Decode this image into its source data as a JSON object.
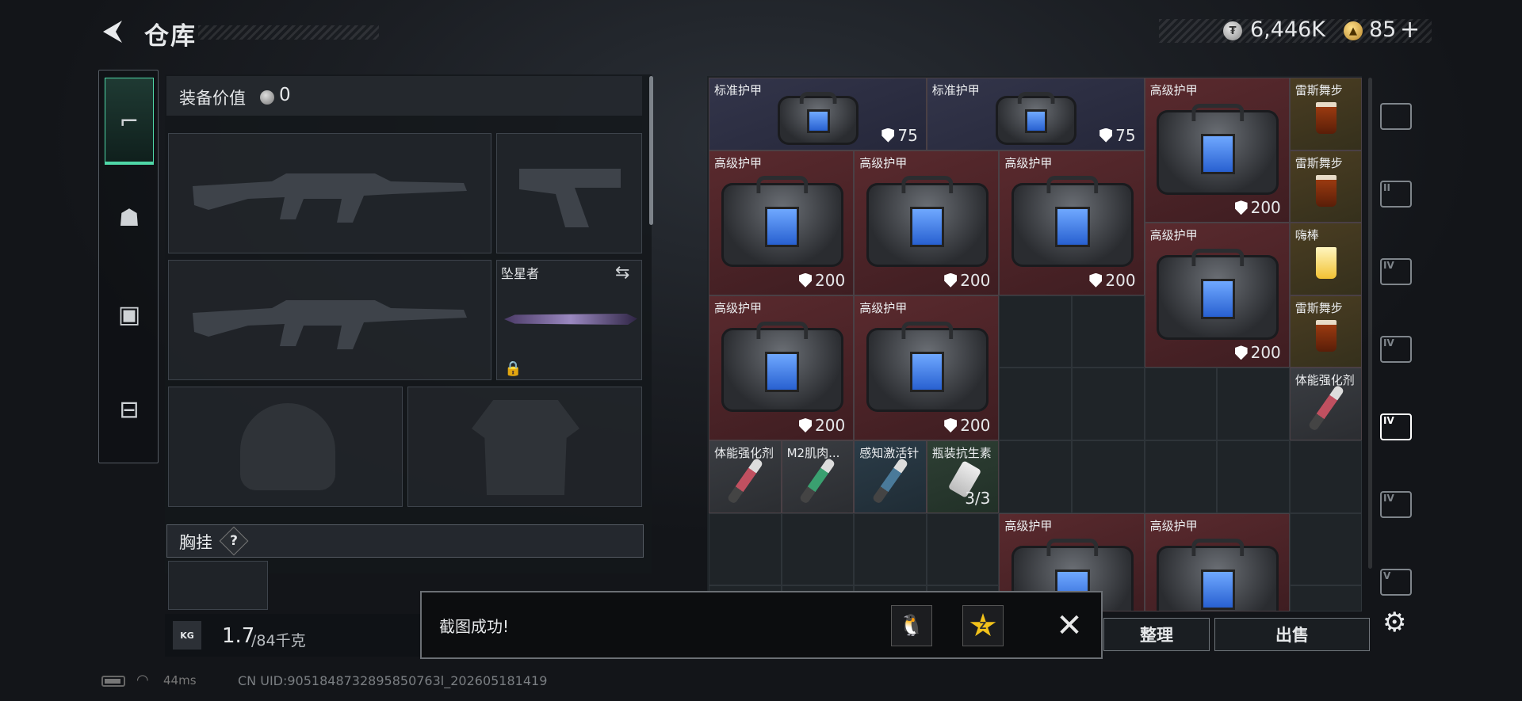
{
  "header": {
    "title": "仓库",
    "currency1": "6,446K",
    "currency2": "85",
    "currency2_plus": "+"
  },
  "equipment": {
    "value_label": "装备价值",
    "value": "0",
    "melee_name": "坠星者",
    "chest_label": "胸挂",
    "chest_help": "?",
    "weight_icon": "KG",
    "weight_current": "1.7",
    "weight_max": "/84千克"
  },
  "left_tabs": [
    "weapon-icon",
    "backpack-icon",
    "vest-icon",
    "toolbox-icon"
  ],
  "grid": {
    "items": [
      {
        "name": "标准护甲",
        "value": "75",
        "col": 0,
        "row": 0,
        "w": 3,
        "h": 1,
        "color": "blue",
        "kind": "bag"
      },
      {
        "name": "标准护甲",
        "value": "75",
        "col": 3,
        "row": 0,
        "w": 3,
        "h": 1,
        "color": "blue",
        "kind": "bag"
      },
      {
        "name": "高级护甲",
        "value": "200",
        "col": 6,
        "row": 0,
        "w": 2,
        "h": 2,
        "color": "red",
        "kind": "bag"
      },
      {
        "name": "雷斯舞步",
        "value": "",
        "col": 8,
        "row": 0,
        "w": 1,
        "h": 1,
        "color": "gold",
        "kind": "drink"
      },
      {
        "name": "雷斯舞步",
        "value": "",
        "col": 8,
        "row": 1,
        "w": 1,
        "h": 1,
        "color": "gold",
        "kind": "drink"
      },
      {
        "name": "高级护甲",
        "value": "200",
        "col": 0,
        "row": 1,
        "w": 2,
        "h": 2,
        "color": "red",
        "kind": "bag"
      },
      {
        "name": "高级护甲",
        "value": "200",
        "col": 2,
        "row": 1,
        "w": 2,
        "h": 2,
        "color": "red",
        "kind": "bag"
      },
      {
        "name": "高级护甲",
        "value": "200",
        "col": 4,
        "row": 1,
        "w": 2,
        "h": 2,
        "color": "red",
        "kind": "bag"
      },
      {
        "name": "高级护甲",
        "value": "200",
        "col": 6,
        "row": 2,
        "w": 2,
        "h": 2,
        "color": "red",
        "kind": "bag"
      },
      {
        "name": "嗨棒",
        "value": "",
        "col": 8,
        "row": 2,
        "w": 1,
        "h": 1,
        "color": "gold",
        "kind": "drink"
      },
      {
        "name": "雷斯舞步",
        "value": "",
        "col": 8,
        "row": 3,
        "w": 1,
        "h": 1,
        "color": "gold",
        "kind": "drink"
      },
      {
        "name": "高级护甲",
        "value": "200",
        "col": 0,
        "row": 3,
        "w": 2,
        "h": 2,
        "color": "red",
        "kind": "bag"
      },
      {
        "name": "高级护甲",
        "value": "200",
        "col": 2,
        "row": 3,
        "w": 2,
        "h": 2,
        "color": "red",
        "kind": "bag"
      },
      {
        "name": "体能强化剂",
        "value": "",
        "col": 8,
        "row": 4,
        "w": 1,
        "h": 1,
        "color": "gray",
        "kind": "syringe"
      },
      {
        "name": "体能强化剂",
        "value": "",
        "col": 0,
        "row": 5,
        "w": 1,
        "h": 1,
        "color": "gray",
        "kind": "syringe"
      },
      {
        "name": "M2肌肉...",
        "value": "",
        "col": 1,
        "row": 5,
        "w": 1,
        "h": 1,
        "color": "gray",
        "kind": "syringe"
      },
      {
        "name": "感知激活针",
        "value": "",
        "col": 2,
        "row": 5,
        "w": 1,
        "h": 1,
        "color": "teal",
        "kind": "syringe"
      },
      {
        "name": "瓶装抗生素",
        "value": "3/3",
        "col": 3,
        "row": 5,
        "w": 1,
        "h": 1,
        "color": "green",
        "kind": "bottle"
      },
      {
        "name": "高级护甲",
        "value": "",
        "col": 4,
        "row": 6,
        "w": 2,
        "h": 2,
        "color": "red",
        "kind": "bag"
      },
      {
        "name": "高级护甲",
        "value": "",
        "col": 6,
        "row": 6,
        "w": 2,
        "h": 2,
        "color": "red",
        "kind": "bag"
      }
    ]
  },
  "right_tabs": [
    "helmet-icon",
    "container-II-icon",
    "container-IV-icon",
    "container-IV-b-icon",
    "medkit-IV-icon",
    "gun-IV-icon",
    "gun-V-icon"
  ],
  "right_labels": [
    "",
    "II",
    "IV",
    "IV",
    "IV",
    "IV",
    "V"
  ],
  "buttons": {
    "sort": "整理",
    "sell": "出售"
  },
  "toast": {
    "message": "截图成功!"
  },
  "status": {
    "ping": "44ms",
    "uid": "CN UID:9051848732895850763l_202605181419"
  }
}
